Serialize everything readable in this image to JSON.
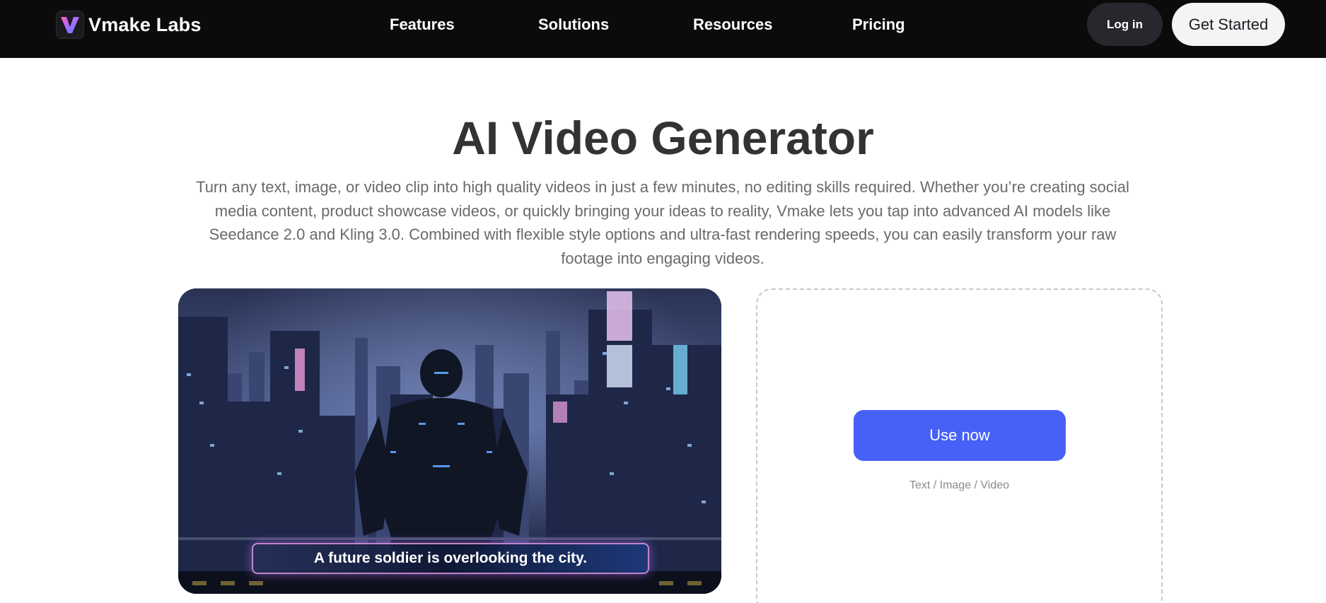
{
  "header": {
    "logo_text": "Vmake Labs",
    "logo_icon": "v-logo-icon",
    "nav": [
      {
        "label": "Features"
      },
      {
        "label": "Solutions"
      },
      {
        "label": "Resources"
      },
      {
        "label": "Pricing"
      }
    ],
    "login_label": "Log in",
    "cta_label": "Get Started"
  },
  "hero": {
    "title": "AI Video Generator",
    "description": "Turn any text, image, or video clip into high quality videos in just a few minutes, no editing skills required. Whether you’re creating social media content, product showcase videos, or quickly bringing your ideas to reality, Vmake lets you tap into advanced AI models like Seedance 2.0 and Kling 3.0. Combined with flexible style options and ultra-fast rendering speeds, you can easily transform your raw footage into engaging videos."
  },
  "preview": {
    "caption": "A future soldier is overlooking the city."
  },
  "upload": {
    "button_label": "Use now",
    "hint": "Text / Image / Video"
  },
  "colors": {
    "header_bg": "#0b0b0c",
    "accent": "#4761f7",
    "title": "#333333",
    "body_text": "#6a6a6a"
  }
}
